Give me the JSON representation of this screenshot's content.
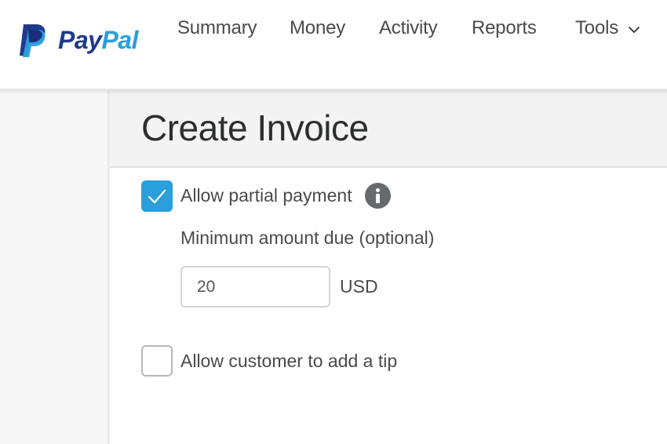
{
  "brand": {
    "name_part1": "Pay",
    "name_part2": "Pal",
    "colors": {
      "dark_blue": "#1e3a8a",
      "light_blue": "#2a9fdc"
    }
  },
  "nav": {
    "items": [
      {
        "label": "Summary"
      },
      {
        "label": "Money"
      },
      {
        "label": "Activity"
      },
      {
        "label": "Reports"
      },
      {
        "label": "Tools",
        "icon": "chevron-down-icon"
      }
    ]
  },
  "page": {
    "title": "Create Invoice"
  },
  "form": {
    "partial_payment": {
      "label": "Allow partial payment",
      "checked": true,
      "info_icon": "info-icon"
    },
    "minimum_amount": {
      "label": "Minimum amount due (optional)",
      "value": "20",
      "currency": "USD"
    },
    "tip": {
      "label": "Allow customer to add a tip",
      "checked": false
    }
  },
  "colors": {
    "accent": "#2a9fdc",
    "info_icon": "#666a6e",
    "header_bg": "#f3f3f3",
    "sidebar_bg": "#f7f7f7"
  }
}
